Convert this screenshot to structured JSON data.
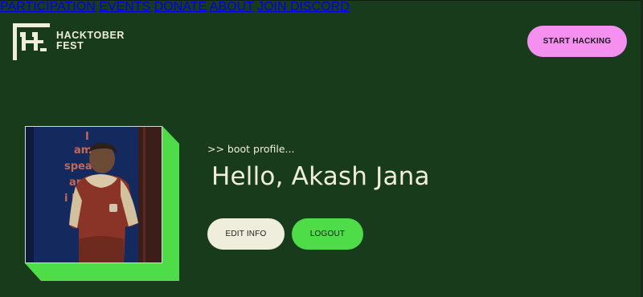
{
  "header": {
    "logo": {
      "line1": "HACKTOBER",
      "line2": "FEST",
      "icon": "hacktoberfest-logo-icon"
    },
    "nav": [
      {
        "label": "PARTICIPATION"
      },
      {
        "label": "EVENTS"
      },
      {
        "label": "DONATE"
      },
      {
        "label": "ABOUT"
      },
      {
        "label": "JOIN DISCORD"
      }
    ],
    "cta_label": "START HACKING"
  },
  "profile": {
    "avatar_icon": "profile-photo",
    "avatar_background_text": [
      "I",
      "am",
      "spea",
      "and",
      "i kn"
    ],
    "boot_text": ">> boot profile...",
    "greeting": "Hello, Akash Jana",
    "edit_label": "EDIT INFO",
    "logout_label": "LOGOUT"
  },
  "colors": {
    "background": "#183b1c",
    "text": "#efeddc",
    "accent_pink": "#f58ff0",
    "accent_green": "#4fdc49",
    "button_light": "#efeddc"
  }
}
